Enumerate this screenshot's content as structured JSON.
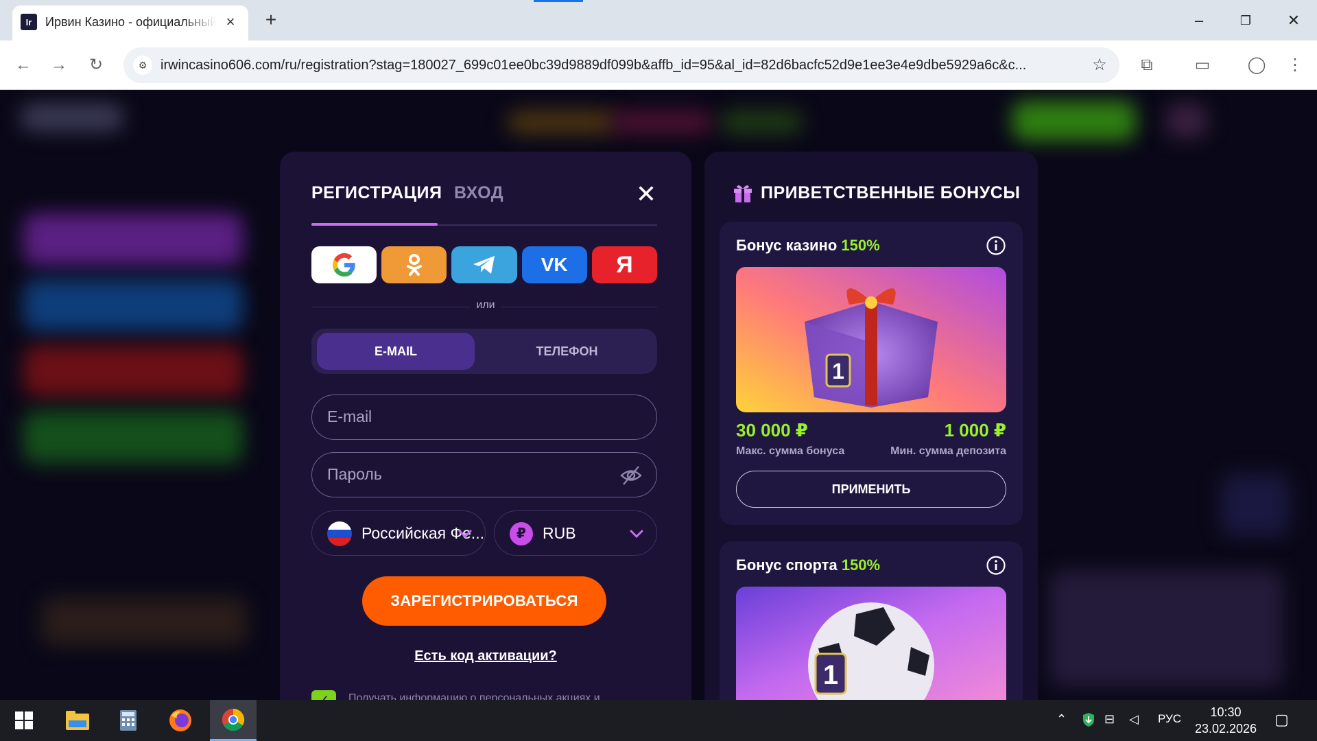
{
  "browser": {
    "tab_title": "Ирвин Казино - официальный сайт",
    "tab_favicon": "Ir",
    "url": "irwincasino606.com/ru/registration?stag=180027_699c01ee0bc39d9889df099b&affb_id=95&al_id=82d6bacfc52d9e1ee3e4e9dbe5929a6c&c..."
  },
  "modal": {
    "tab_register": "РЕГИСТРАЦИЯ",
    "tab_login": "ВХОД",
    "social": {
      "google": "G",
      "ok": "ok-icon",
      "telegram": "telegram-icon",
      "vk": "VK",
      "yandex": "Я"
    },
    "or_label": "или",
    "method_email": "E-MAIL",
    "method_phone": "ТЕЛЕФОН",
    "email_placeholder": "E-mail",
    "password_placeholder": "Пароль",
    "country": "Российская Фе...",
    "currency_symbol": "₽",
    "currency": "RUB",
    "register_button": "ЗАРЕГИСТРИРОВАТЬСЯ",
    "promo_link": "Есть код активации?",
    "consent_text": "Получать информацию о персональных акциях и"
  },
  "bonus": {
    "heading": "ПРИВЕТСТВЕННЫЕ БОНУСЫ",
    "casino": {
      "title": "Бонус казино",
      "percent": "150%",
      "max_amount": "30 000 ₽",
      "max_label": "Макс. сумма бонуса",
      "min_amount": "1 000 ₽",
      "min_label": "Мин. сумма депозита",
      "apply": "ПРИМЕНИТЬ",
      "badge": "1"
    },
    "sport": {
      "title": "Бонус спорта",
      "percent": "150%",
      "badge": "1"
    }
  },
  "taskbar": {
    "language": "РУС",
    "time": "10:30",
    "date": "23.02.2026"
  },
  "colors": {
    "accent_orange": "#ff5c00",
    "accent_green": "#9af02a",
    "modal_bg": "#1c1236",
    "tab_underline": "#c86cf0"
  }
}
